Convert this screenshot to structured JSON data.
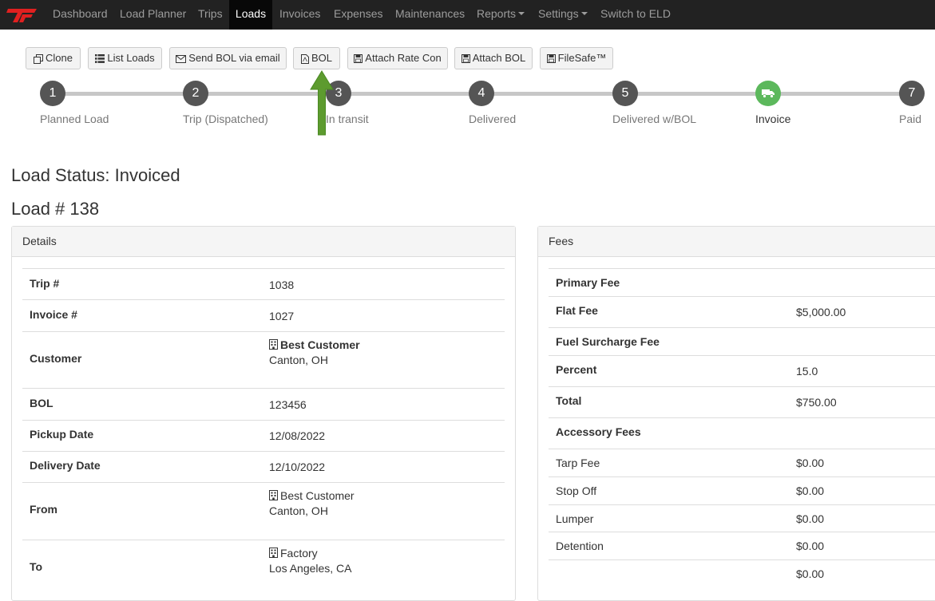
{
  "nav": {
    "items": [
      {
        "label": "Dashboard"
      },
      {
        "label": "Load Planner"
      },
      {
        "label": "Trips"
      },
      {
        "label": "Loads"
      },
      {
        "label": "Invoices"
      },
      {
        "label": "Expenses"
      },
      {
        "label": "Maintenances"
      },
      {
        "label": "Reports"
      },
      {
        "label": "Settings"
      },
      {
        "label": "Switch to ELD"
      }
    ],
    "active": "Loads"
  },
  "toolbar": {
    "clone": "Clone",
    "list_loads": "List Loads",
    "send_bol": "Send BOL via email",
    "bol": "BOL",
    "attach_rate_con": "Attach Rate Con",
    "attach_bol": "Attach BOL",
    "filesafe": "FileSafe™"
  },
  "steps": [
    {
      "number": "1",
      "label": "Planned Load"
    },
    {
      "number": "2",
      "label": "Trip (Dispatched)"
    },
    {
      "number": "3",
      "label": "In transit"
    },
    {
      "number": "4",
      "label": "Delivered"
    },
    {
      "number": "5",
      "label": "Delivered w/BOL"
    },
    {
      "number": "",
      "label": "Invoice",
      "icon": "truck-icon",
      "current": true
    },
    {
      "number": "7",
      "label": "Paid"
    }
  ],
  "colors": {
    "current_step": "#5cb85c",
    "step": "#555555",
    "link": "#337ab7",
    "arrow": "#5d9b2f"
  },
  "load_status": "Load Status: Invoiced",
  "load_number": "Load # 138",
  "details": {
    "title": "Details",
    "trip_label": "Trip #",
    "trip_value": "1038",
    "invoice_label": "Invoice #",
    "invoice_value": "1027",
    "customer_label": "Customer",
    "customer_name": "Best Customer",
    "customer_city": "Canton, OH",
    "bol_label": "BOL",
    "bol_value": "123456",
    "pickup_label": "Pickup Date",
    "pickup_value": "12/08/2022",
    "delivery_label": "Delivery Date",
    "delivery_value": "12/10/2022",
    "from_label": "From",
    "from_name": "Best Customer",
    "from_city": "Canton, OH",
    "to_label": "To",
    "to_name": "Factory",
    "to_city": "Los Angeles, CA"
  },
  "fees": {
    "title": "Fees",
    "primary_fee": "Primary Fee",
    "flat_fee_label": "Flat Fee",
    "flat_fee_value": "$5,000.00",
    "fuel_surcharge": "Fuel Surcharge Fee",
    "percent_label": "Percent",
    "percent_value": "15.0",
    "total_label": "Total",
    "total_value": "$750.00",
    "accessory_fees": "Accessory Fees",
    "tarp_label": "Tarp Fee",
    "tarp_value": "$0.00",
    "stop_label": "Stop Off",
    "stop_value": "$0.00",
    "lumper_label": "Lumper",
    "lumper_value": "$0.00",
    "detention_label": "Detention",
    "detention_value": "$0.00",
    "extra_value": "$0.00"
  }
}
